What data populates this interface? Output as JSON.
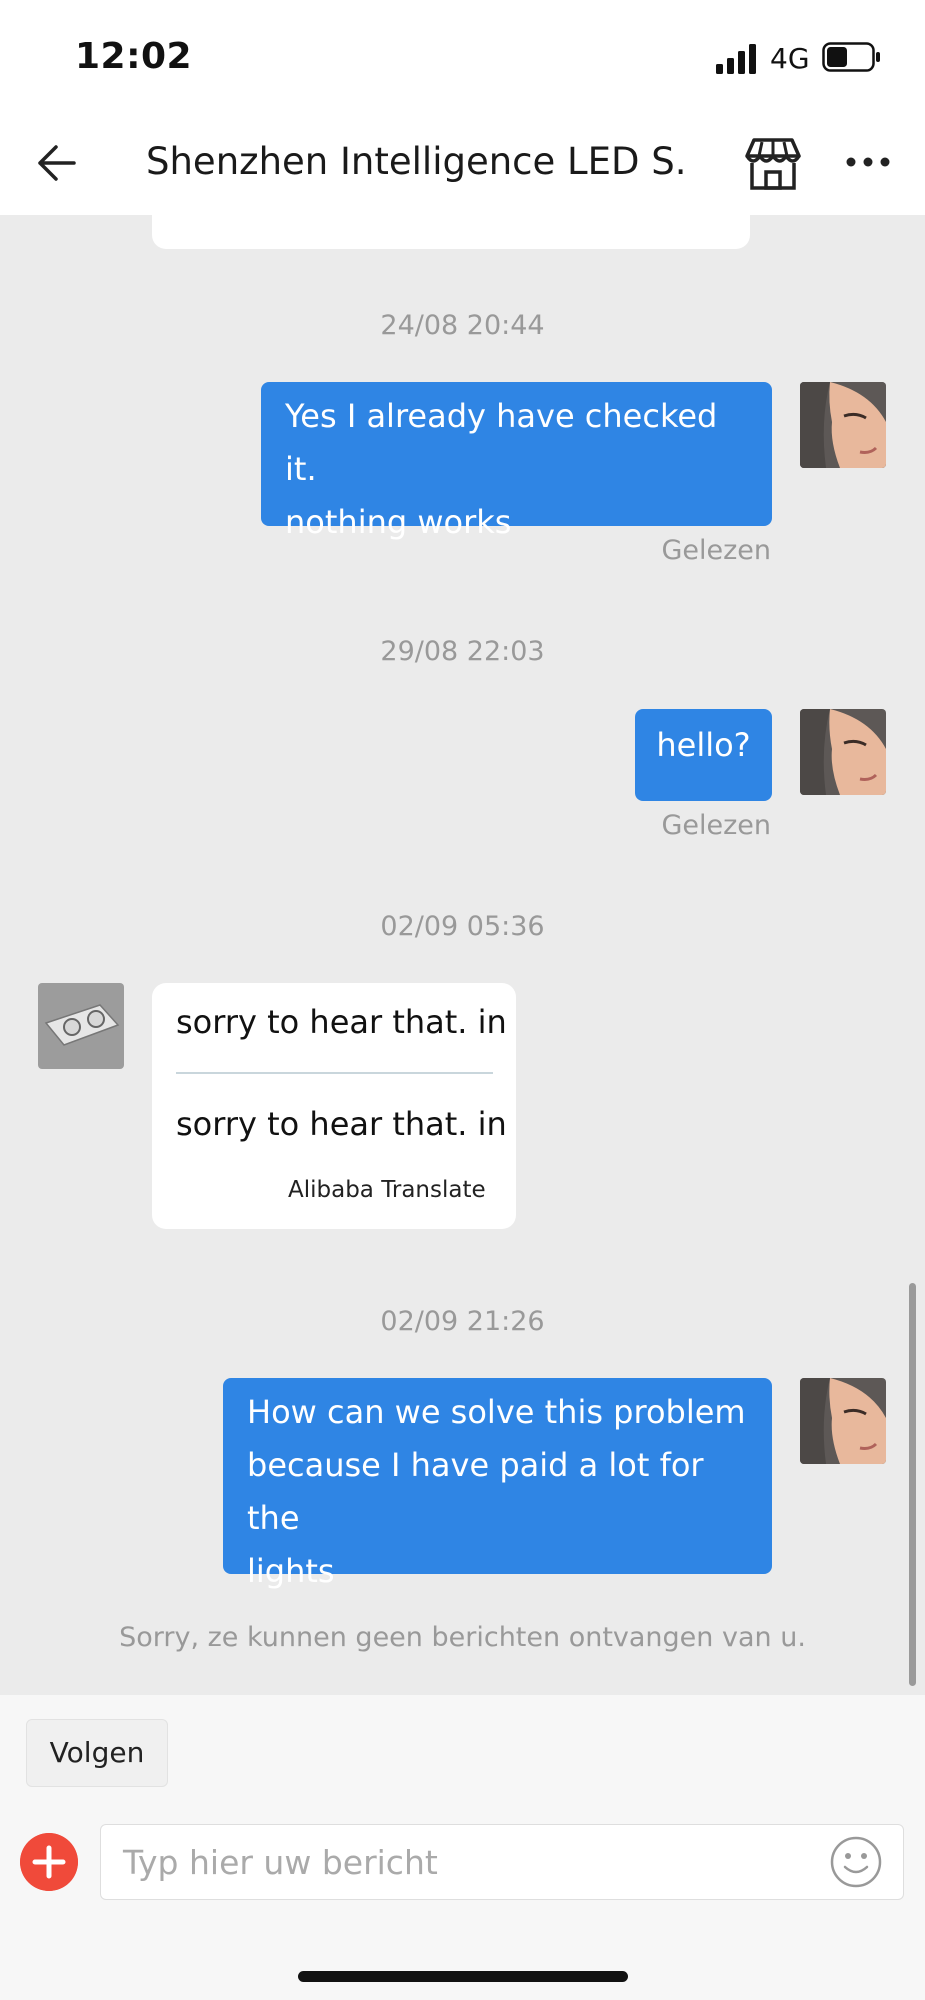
{
  "status_bar": {
    "time": "12:02",
    "network": "4G"
  },
  "header": {
    "title": "Shenzhen Intelligence LED S..."
  },
  "messages": [
    {
      "timestamp": "24/08 20:44",
      "text_lines": [
        "Yes I already have checked it.",
        "nothing works"
      ],
      "status": "Gelezen"
    },
    {
      "timestamp": "29/08 22:03",
      "text_lines": [
        "hello?"
      ],
      "status": "Gelezen"
    },
    {
      "timestamp": "02/09 05:36",
      "original": "sorry to hear that. in",
      "translated": "sorry to hear that. in",
      "translate_label": "Alibaba Translate"
    },
    {
      "timestamp": "02/09 21:26",
      "text_lines": [
        "How can we solve this problem",
        "because I have paid a lot for the",
        "lights"
      ]
    }
  ],
  "notice": "Sorry, ze kunnen geen berichten ontvangen van u.",
  "follow_button": "Volgen",
  "input": {
    "placeholder": "Typ hier uw bericht"
  },
  "colors": {
    "accent_blue": "#2f85e4",
    "plus_red": "#f04a3a",
    "chat_bg": "#ebebeb"
  }
}
